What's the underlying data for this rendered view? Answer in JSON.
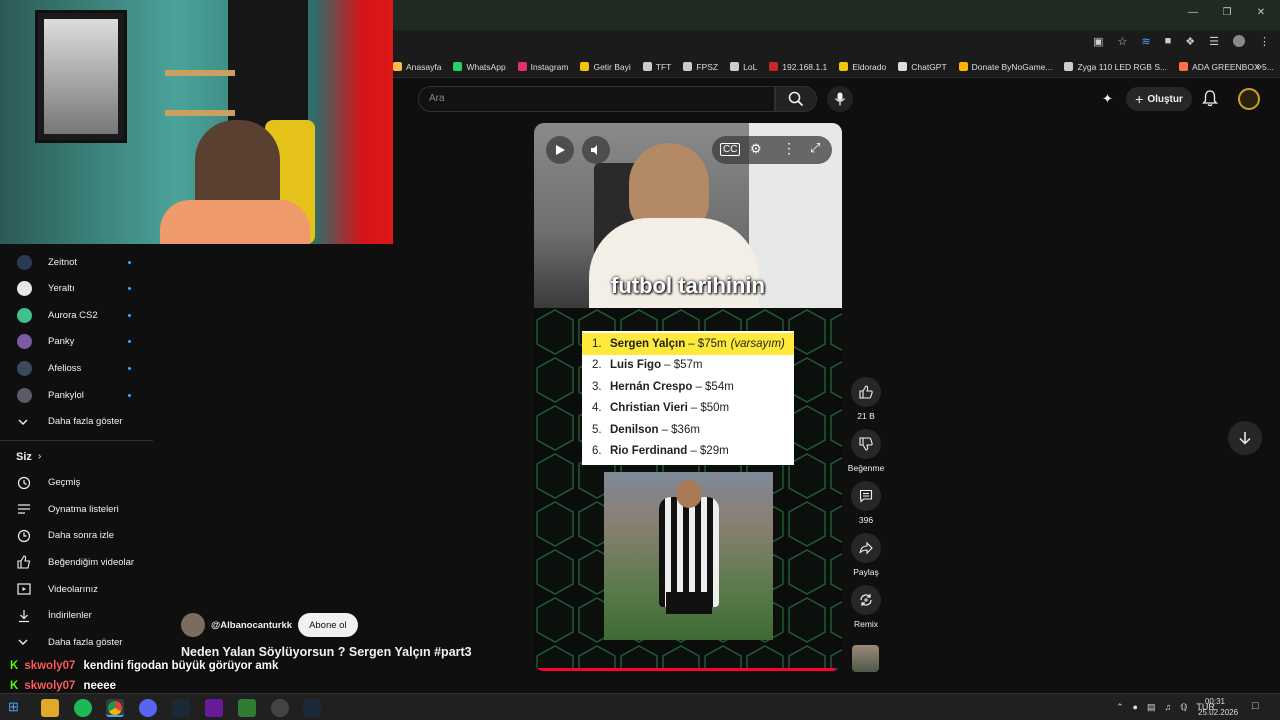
{
  "browser": {
    "bookmarks": [
      "Anasayfa",
      "WhatsApp",
      "Instagram",
      "Getir Bayi",
      "TFT",
      "FPSZ",
      "LoL",
      "192.168.1.1",
      "Eldorado",
      "ChatGPT",
      "Donate ByNoGame...",
      "Zyga 110 LED RGB S...",
      "ADA GREENBOX 5..."
    ],
    "bookmark_colors": [
      "#ffb84d",
      "#25d366",
      "#e1306c",
      "#f5c400",
      "#cccccc",
      "#cccccc",
      "#cccccc",
      "#c62828",
      "#f1c40f",
      "#dddddd",
      "#ffb300",
      "#cccccc",
      "#ff7043"
    ]
  },
  "header": {
    "search_placeholder": "Ara",
    "create_label": "Oluştur"
  },
  "sidebar": {
    "subscriptions": [
      {
        "name": "Zeitnot",
        "color": "#2a3a55"
      },
      {
        "name": "Yeraltı",
        "color": "#e6e6e6"
      },
      {
        "name": "Aurora CS2",
        "color": "#3fc08c"
      },
      {
        "name": "Panky",
        "color": "#7a5aa0"
      },
      {
        "name": "Afelioss",
        "color": "#3a4a5a"
      },
      {
        "name": "Pankylol",
        "color": "#5a5a6a"
      }
    ],
    "show_more_1": "Daha fazla göster",
    "you_label": "Siz",
    "you_items": [
      "Geçmiş",
      "Oynatma listeleri",
      "Daha sonra izle",
      "Beğendiğim videolar",
      "Videolarınız",
      "İndirilenler"
    ],
    "show_more_2": "Daha fazla göster"
  },
  "short": {
    "caption": "futbol tarihinin",
    "ranking": [
      {
        "rank": "1.",
        "name": "Sergen Yalçın",
        "value": "– $75m",
        "note": "(varsayım)"
      },
      {
        "rank": "2.",
        "name": "Luis Figo",
        "value": "– $57m",
        "note": ""
      },
      {
        "rank": "3.",
        "name": "Hernán Crespo",
        "value": "– $54m",
        "note": ""
      },
      {
        "rank": "4.",
        "name": "Christian Vieri",
        "value": "– $50m",
        "note": ""
      },
      {
        "rank": "5.",
        "name": "Denilson",
        "value": "– $36m",
        "note": ""
      },
      {
        "rank": "6.",
        "name": "Rio Ferdinand",
        "value": "– $29m",
        "note": ""
      }
    ],
    "channel": "@Albanocanturkk",
    "subscribe_label": "Abone ol",
    "title": "Neden Yalan Söylüyorsun ? Sergen Yalçın #part3",
    "progress": 0.99
  },
  "actions": {
    "like_count": "21 B",
    "dislike_label": "Beğenme",
    "comment_count": "396",
    "share_label": "Paylaş",
    "remix_label": "Remix"
  },
  "chat": [
    {
      "user": "skwoly07",
      "text": "kendini figodan büyük görüyor amk"
    },
    {
      "user": "skwoly07",
      "text": "neeee"
    }
  ],
  "taskbar": {
    "lang": "TUR",
    "time": "00:31",
    "date": "25.02.2026"
  }
}
